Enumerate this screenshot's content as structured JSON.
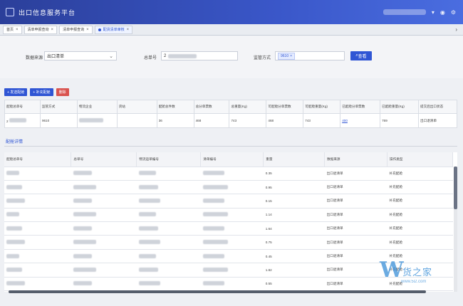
{
  "app": {
    "title": "出口信息服务平台"
  },
  "tabs": [
    {
      "label": "首页",
      "active": false
    },
    {
      "label": "清单申报查询",
      "active": false
    },
    {
      "label": "清单申报查询",
      "active": false
    },
    {
      "label": "配货清单审核",
      "active": true
    }
  ],
  "filter": {
    "source_label": "数据来源",
    "source_value": "出口清单",
    "total_no_label": "总单号",
    "total_no_prefix": "2",
    "supervision_label": "监管方式",
    "supervision_chip": "9610",
    "search_button": "查看"
  },
  "actions": {
    "add_order": "+ 发送配舱",
    "add_allocation": "+ 补充配舱",
    "delete": "删除"
  },
  "summary_table": {
    "headers": [
      "配舱总单号",
      "监管方式",
      "物流企业",
      "货站",
      "配舱总件数",
      "总分单票数",
      "总重量(Kg)",
      "可配舱分单票数",
      "可配舱重量(Kg)",
      "已配舱分单票数",
      "已配舱重量(Kg)",
      "提交后出口状态"
    ],
    "row": {
      "order_prefix": "2",
      "supervision": "9610",
      "total_pieces": "36",
      "total_tickets": "468",
      "total_weight": "743",
      "avail_tickets": "468",
      "avail_weight": "743",
      "allocated_tickets": "400",
      "allocated_weight": "769",
      "status": "出口退清单"
    }
  },
  "detail": {
    "tab_label": "配舱详情",
    "headers": [
      "配舱总单号",
      "总单号",
      "物流运单编号",
      "清单编号",
      "重量",
      "数据来源",
      "操作类型"
    ],
    "rows": [
      {
        "weight": "0.35",
        "source": "出口退清单",
        "op": "补充配舱"
      },
      {
        "weight": "0.95",
        "source": "出口退清单",
        "op": "补充配舱"
      },
      {
        "weight": "0.15",
        "source": "出口退清单",
        "op": "补充配舱"
      },
      {
        "weight": "1.14",
        "source": "出口退清单",
        "op": "补充配舱"
      },
      {
        "weight": "1.64",
        "source": "出口退清单",
        "op": "补充配舱"
      },
      {
        "weight": "0.75",
        "source": "出口退清单",
        "op": "补充配舱"
      },
      {
        "weight": "0.45",
        "source": "出口退清单",
        "op": "补充配舱"
      },
      {
        "weight": "1.82",
        "source": "出口退清单",
        "op": "补充配舱"
      },
      {
        "weight": "0.55",
        "source": "出口退清单",
        "op": "补充配舱"
      }
    ]
  },
  "watermark": {
    "brand": "货之家",
    "url": "www.5i2.com"
  }
}
